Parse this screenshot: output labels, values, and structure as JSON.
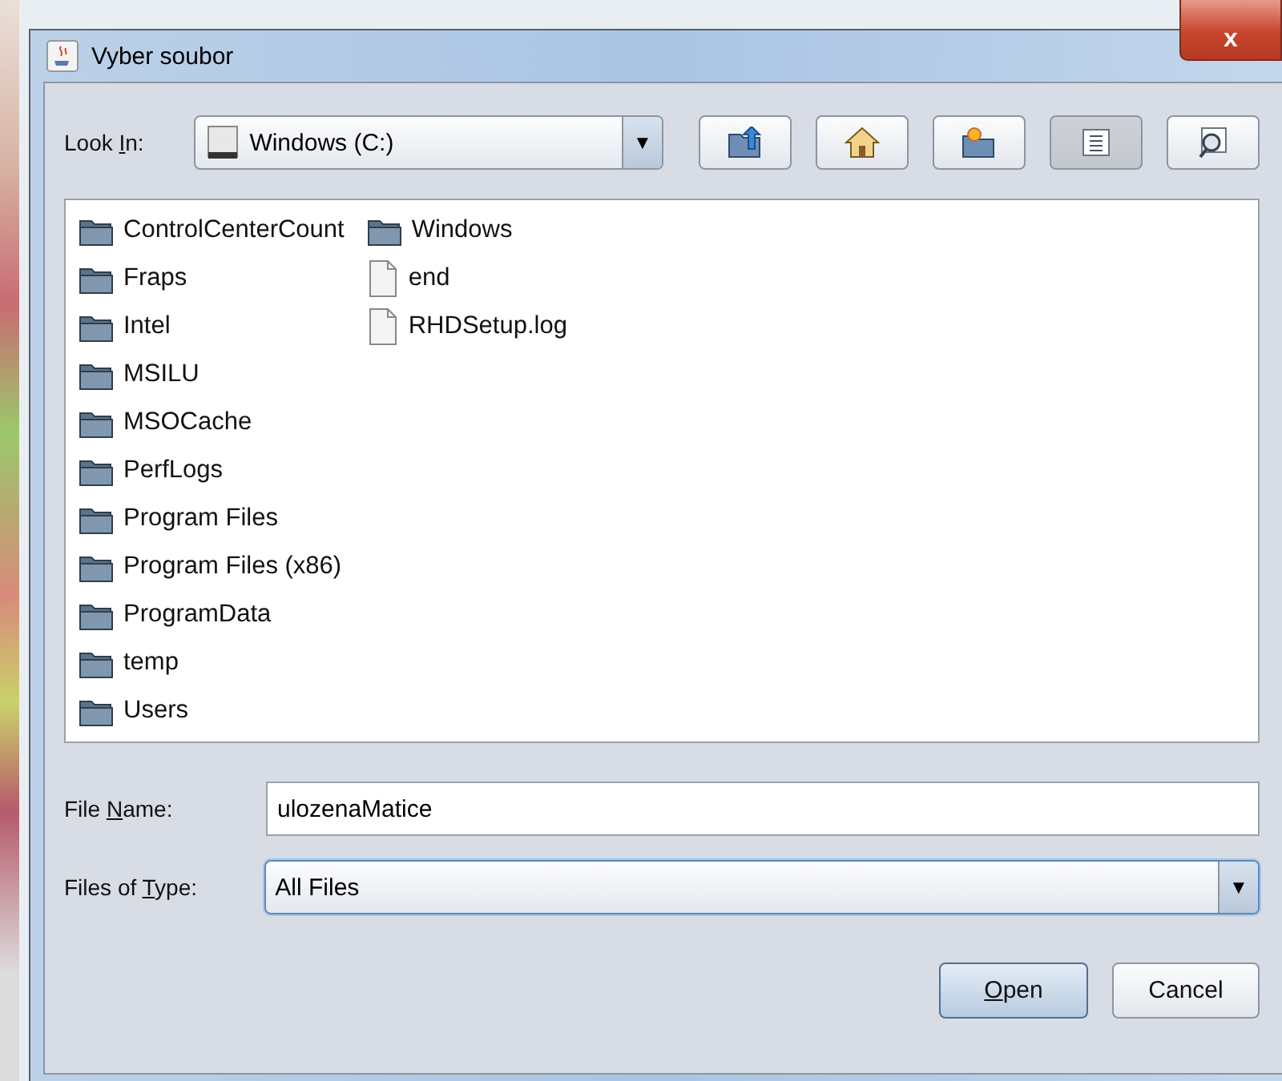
{
  "window": {
    "title": "Vyber soubor",
    "close": "x"
  },
  "look_in": {
    "label": {
      "before": "Look ",
      "key": "I",
      "after": "n:"
    },
    "value": "Windows (C:)",
    "arrow": "▼"
  },
  "toolbar": [
    {
      "kind": "up",
      "selected": false
    },
    {
      "kind": "home",
      "selected": false
    },
    {
      "kind": "new-folder",
      "selected": false
    },
    {
      "kind": "list",
      "selected": true
    },
    {
      "kind": "details",
      "selected": false
    }
  ],
  "files": [
    {
      "name": "ControlCenterCount",
      "kind": "folder"
    },
    {
      "name": "Fraps",
      "kind": "folder"
    },
    {
      "name": "Intel",
      "kind": "folder"
    },
    {
      "name": "MSILU",
      "kind": "folder"
    },
    {
      "name": "MSOCache",
      "kind": "folder"
    },
    {
      "name": "PerfLogs",
      "kind": "folder"
    },
    {
      "name": "Program Files",
      "kind": "folder"
    },
    {
      "name": "Program Files (x86)",
      "kind": "folder"
    },
    {
      "name": "ProgramData",
      "kind": "folder"
    },
    {
      "name": "temp",
      "kind": "folder"
    },
    {
      "name": "Users",
      "kind": "folder"
    },
    {
      "name": "Windows",
      "kind": "folder"
    },
    {
      "name": "end",
      "kind": "file"
    },
    {
      "name": "RHDSetup.log",
      "kind": "file"
    }
  ],
  "file_name": {
    "label": {
      "before": "File ",
      "key": "N",
      "after": "ame:"
    },
    "value": "ulozenaMatice"
  },
  "file_type": {
    "label": {
      "before": "Files of ",
      "key": "T",
      "after": "ype:"
    },
    "value": "All Files",
    "arrow": "▼"
  },
  "buttons": [
    {
      "label": {
        "key": "O",
        "after": "pen"
      },
      "kind": "default"
    },
    {
      "label": {
        "before": "Cancel"
      },
      "kind": "normal"
    }
  ]
}
